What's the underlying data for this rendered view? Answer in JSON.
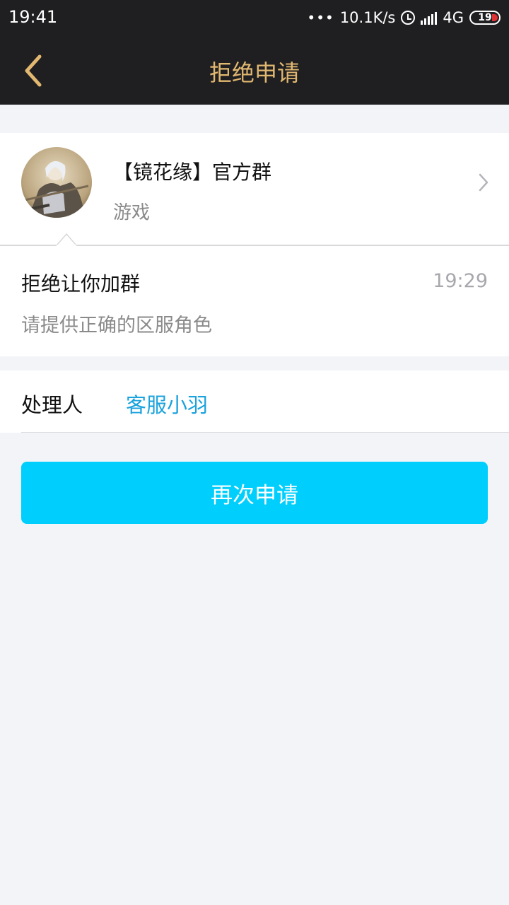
{
  "status_bar": {
    "time": "19:41",
    "dots": "•••",
    "network_speed": "10.1K/s",
    "network_type": "4G",
    "battery": "19"
  },
  "nav": {
    "title": "拒绝申请",
    "back_icon": "chevron-left-icon",
    "title_color": "#e2b871"
  },
  "group": {
    "name": "【镜花缘】官方群",
    "category": "游戏",
    "chevron_icon": "chevron-right-icon"
  },
  "message": {
    "title": "拒绝让你加群",
    "time": "19:29",
    "detail": "请提供正确的区服角色"
  },
  "handler": {
    "label": "处理人",
    "name": "客服小羽",
    "name_color": "#1aa2dd"
  },
  "actions": {
    "reapply_label": "再次申请",
    "button_color": "#00cffd"
  }
}
